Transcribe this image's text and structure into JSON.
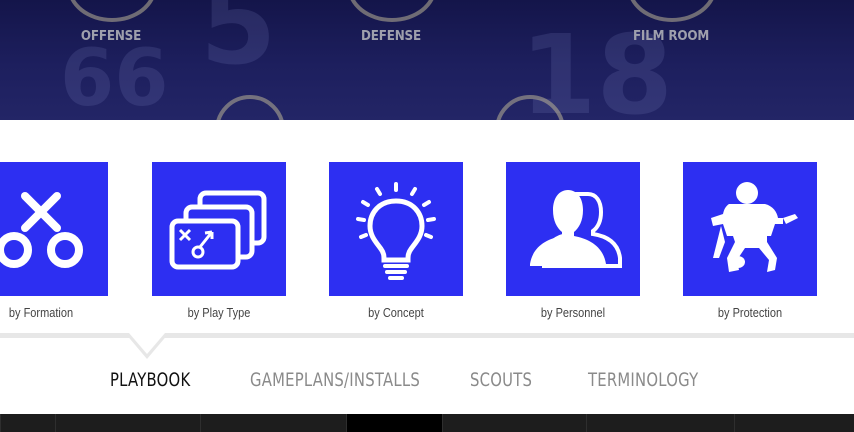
{
  "colors": {
    "hero_bg": "#1d1f5e",
    "tile_blue": "#2d2ff2",
    "tab_active": "#111111",
    "tab_inactive": "#8a8a8a"
  },
  "hero": {
    "bg_numbers": [
      "66",
      "18",
      "5"
    ],
    "links": [
      {
        "label": "OFFENSE",
        "icon": "offense-icon"
      },
      {
        "label": "DEFENSE",
        "icon": "defense-icon"
      },
      {
        "label": "FILM ROOM",
        "icon": "film-room-icon"
      }
    ]
  },
  "categories": [
    {
      "label": "by Formation",
      "icon": "formation-icon"
    },
    {
      "label": "by Play Type",
      "icon": "play-type-icon"
    },
    {
      "label": "by Concept",
      "icon": "lightbulb-icon"
    },
    {
      "label": "by Personnel",
      "icon": "personnel-icon"
    },
    {
      "label": "by Protection",
      "icon": "lineman-icon"
    }
  ],
  "tabs": [
    {
      "label": "PLAYBOOK",
      "active": true
    },
    {
      "label": "GAMEPLANS/INSTALLS",
      "active": false
    },
    {
      "label": "SCOUTS",
      "active": false
    },
    {
      "label": "TERMINOLOGY",
      "active": false
    }
  ]
}
